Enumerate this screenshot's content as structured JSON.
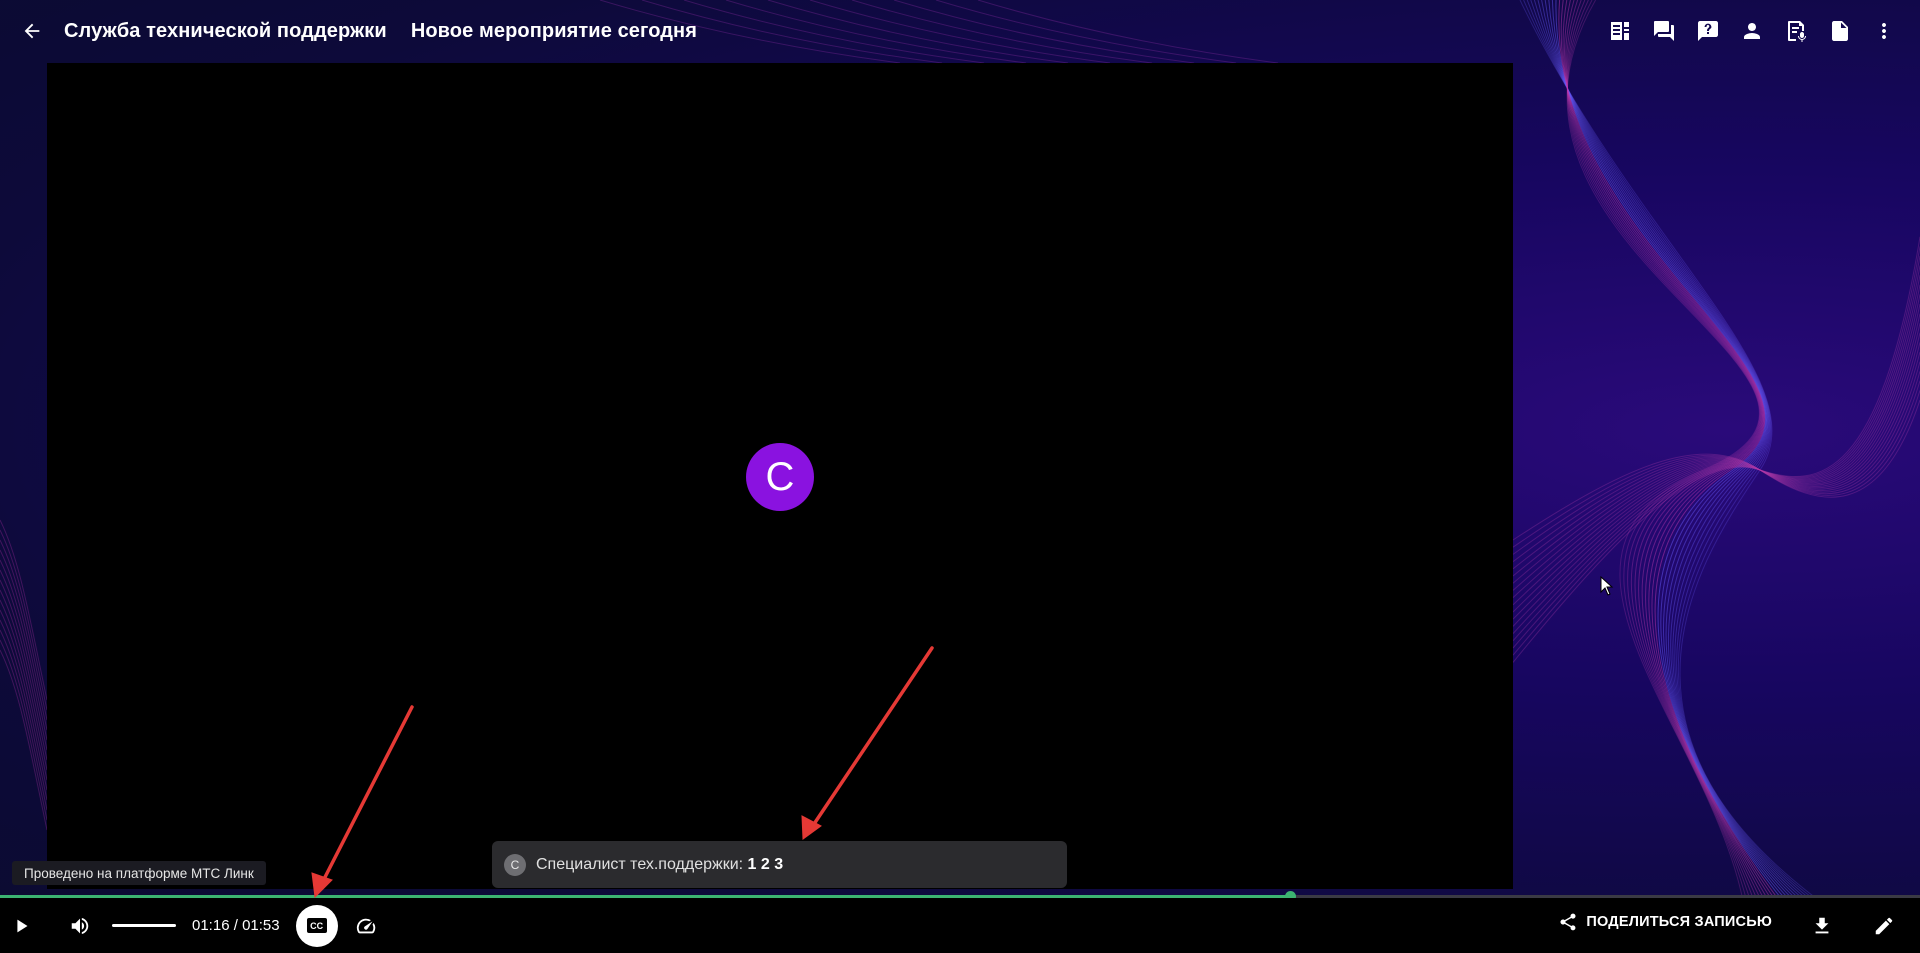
{
  "header": {
    "title": "Служба технической поддержки",
    "subtitle": "Новое мероприятие сегодня",
    "icons": [
      "agenda-icon",
      "chat-icon",
      "question-icon",
      "participants-icon",
      "transcript-icon",
      "file-icon",
      "more-vert-icon"
    ]
  },
  "video": {
    "speaker_initial": "С"
  },
  "caption": {
    "avatar_initial": "С",
    "speaker": "Специалист тех.поддержки:",
    "text": "1 2 3"
  },
  "platform_tag": "Проведено на платформе МТС Линк",
  "player": {
    "current_time": "01:16",
    "separator": " / ",
    "duration": "01:53",
    "progress_fraction": 0.672,
    "cc_label": "CC",
    "share_label": "ПОДЕЛИТЬСЯ ЗАПИСЬЮ",
    "accent_color": "#3cb371"
  },
  "colors": {
    "background": "#140a4a",
    "avatar": "#8a12e0",
    "annotation_arrow": "#e53935"
  }
}
